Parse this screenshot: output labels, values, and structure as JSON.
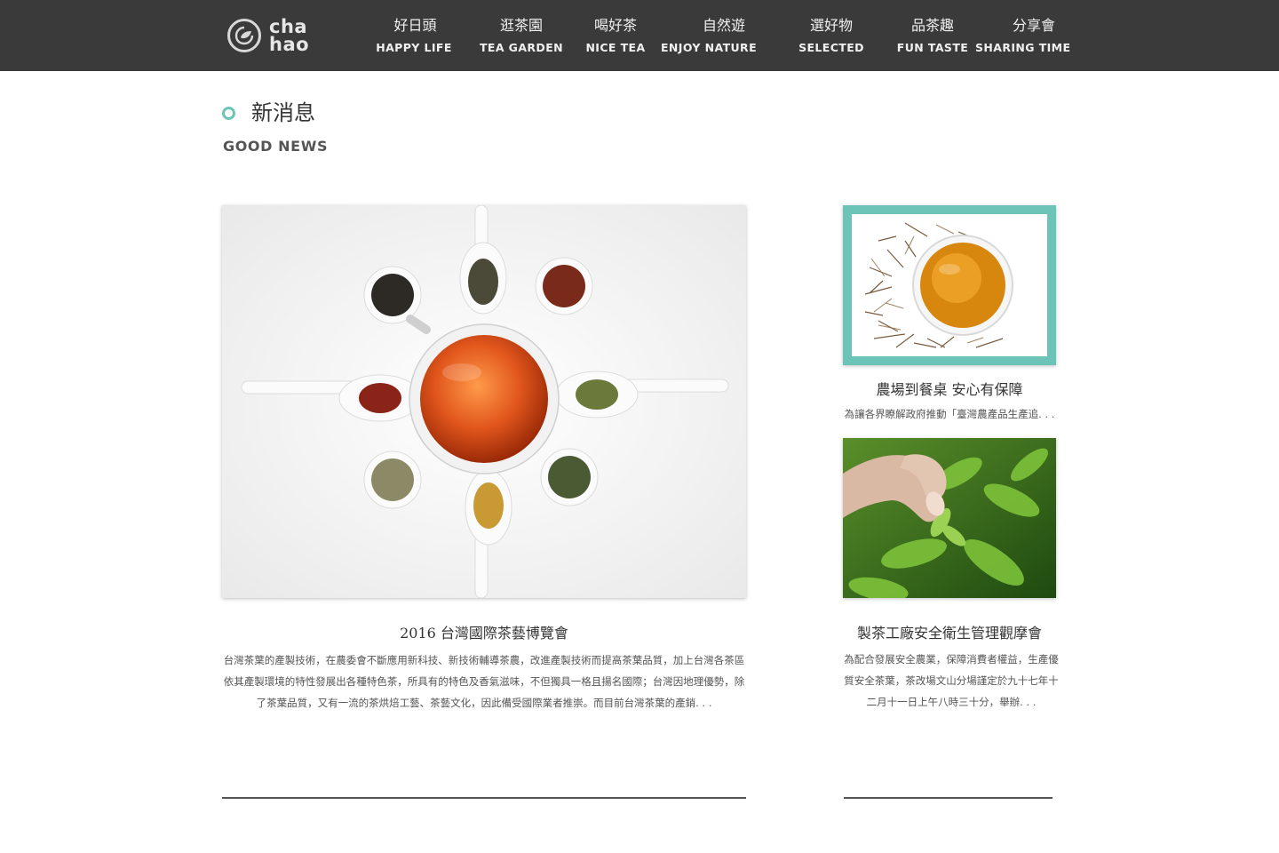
{
  "header": {
    "logo": {
      "line1": "cha",
      "line2": "hao"
    },
    "nav": [
      {
        "zh": "好日頭",
        "en": "HAPPY LIFE"
      },
      {
        "zh": "逛茶園",
        "en": "TEA GARDEN"
      },
      {
        "zh": "喝好茶",
        "en": "NICE TEA"
      },
      {
        "zh": "自然遊",
        "en": "ENJOY NATURE"
      },
      {
        "zh": "選好物",
        "en": "SELECTED"
      },
      {
        "zh": "品茶趣",
        "en": "FUN TASTE"
      },
      {
        "zh": "分享會",
        "en": "SHARING TIME"
      }
    ]
  },
  "section": {
    "title": "新消息",
    "subtitle": "GOOD NEWS"
  },
  "feature": {
    "title": "2016 台灣國際茶藝博覽會",
    "desc": "台灣茶葉的產製技術，在農委會不斷應用新科技、新技術輔導茶農，改進產製技術而提高茶葉品質，加上台灣各茶區依其產製環境的特性發展出各種特色茶，所具有的特色及香氣滋味，不但獨具一格且揚名國際；台灣因地理優勢，除了茶葉品質，又有一流的茶烘焙工藝、茶藝文化，因此備受國際業者推崇。而目前台灣茶葉的產銷. . ."
  },
  "side": [
    {
      "title": "農場到餐桌  安心有保障",
      "desc": "為讓各界瞭解政府推動「臺灣農產品生產追. . ."
    },
    {
      "title": "製茶工廠安全衛生管理觀摩會",
      "desc": "為配合發展安全農業，保障消費者權益，生產優質安全茶葉，茶改場文山分場謹定於九十七年十二月十一日上午八時三十分，舉辦. . ."
    }
  ],
  "colors": {
    "header_bg": "#3a3a3a",
    "accent": "#6cc3b8"
  }
}
